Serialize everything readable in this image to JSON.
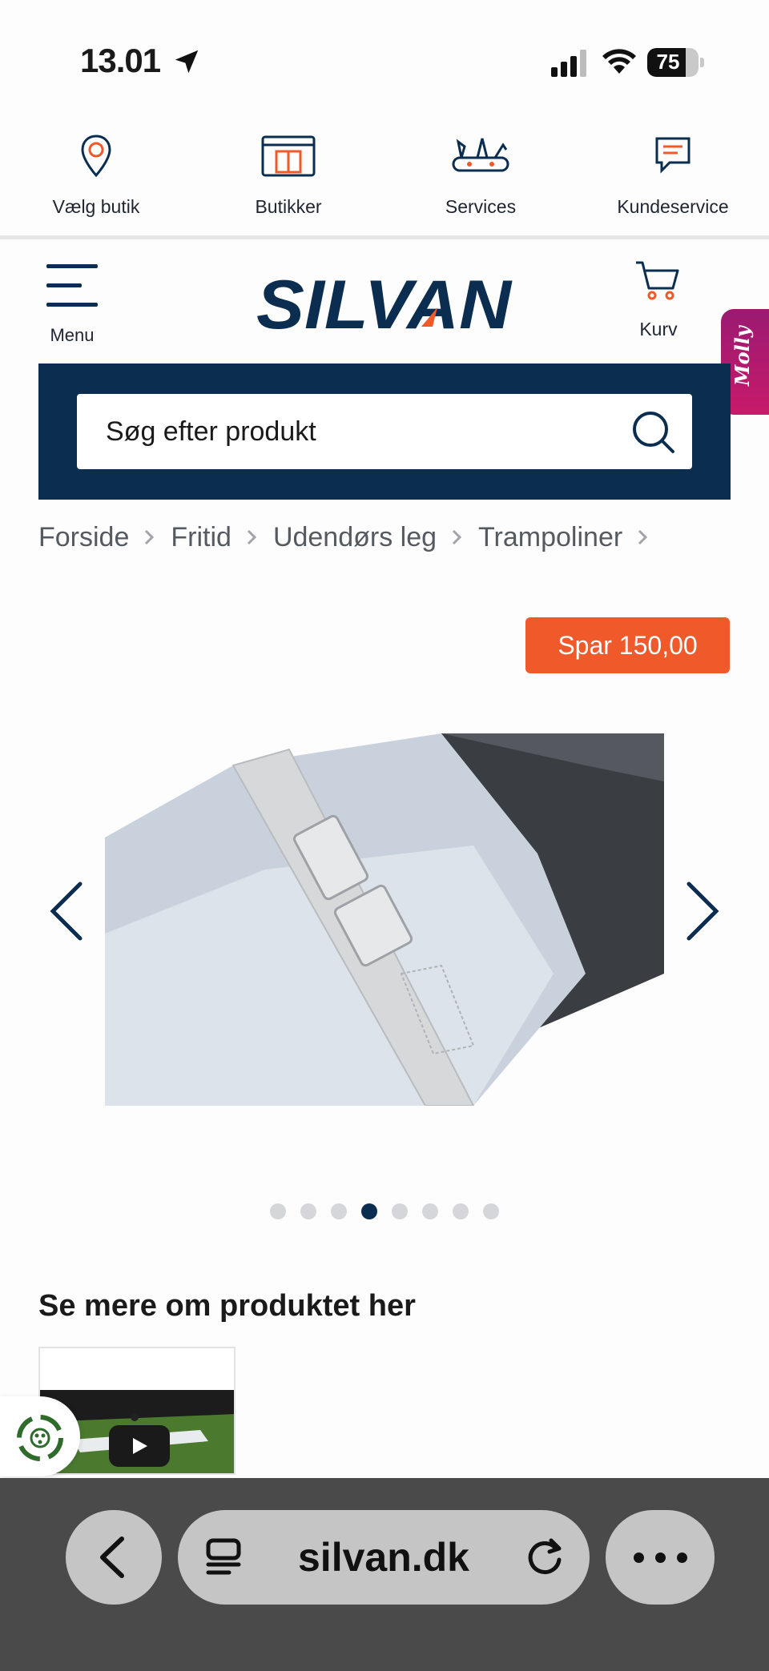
{
  "status_bar": {
    "time": "13.01",
    "battery": "75",
    "battery_level": 0.75
  },
  "service_nav": [
    {
      "label": "Vælg butik",
      "icon": "location-pin-icon"
    },
    {
      "label": "Butikker",
      "icon": "store-icon"
    },
    {
      "label": "Services",
      "icon": "tools-icon"
    },
    {
      "label": "Kundeservice",
      "icon": "chat-icon"
    }
  ],
  "header": {
    "menu_label": "Menu",
    "logo_text": "SILVAN",
    "cart_label": "Kurv",
    "molly_label": "Molly"
  },
  "search": {
    "placeholder": "Søg efter produkt"
  },
  "breadcrumb": [
    "Forside",
    "Fritid",
    "Udendørs leg",
    "Trampoliner"
  ],
  "product": {
    "save_badge": "Spar 150,00",
    "image_count": 8,
    "active_image_index": 3
  },
  "section": {
    "title": "Se mere om produktet her"
  },
  "colors": {
    "brand_navy": "#0b2d4f",
    "accent_orange": "#f05a2a",
    "molly_magenta": "#b01a6e"
  },
  "browser": {
    "url": "silvan.dk"
  }
}
